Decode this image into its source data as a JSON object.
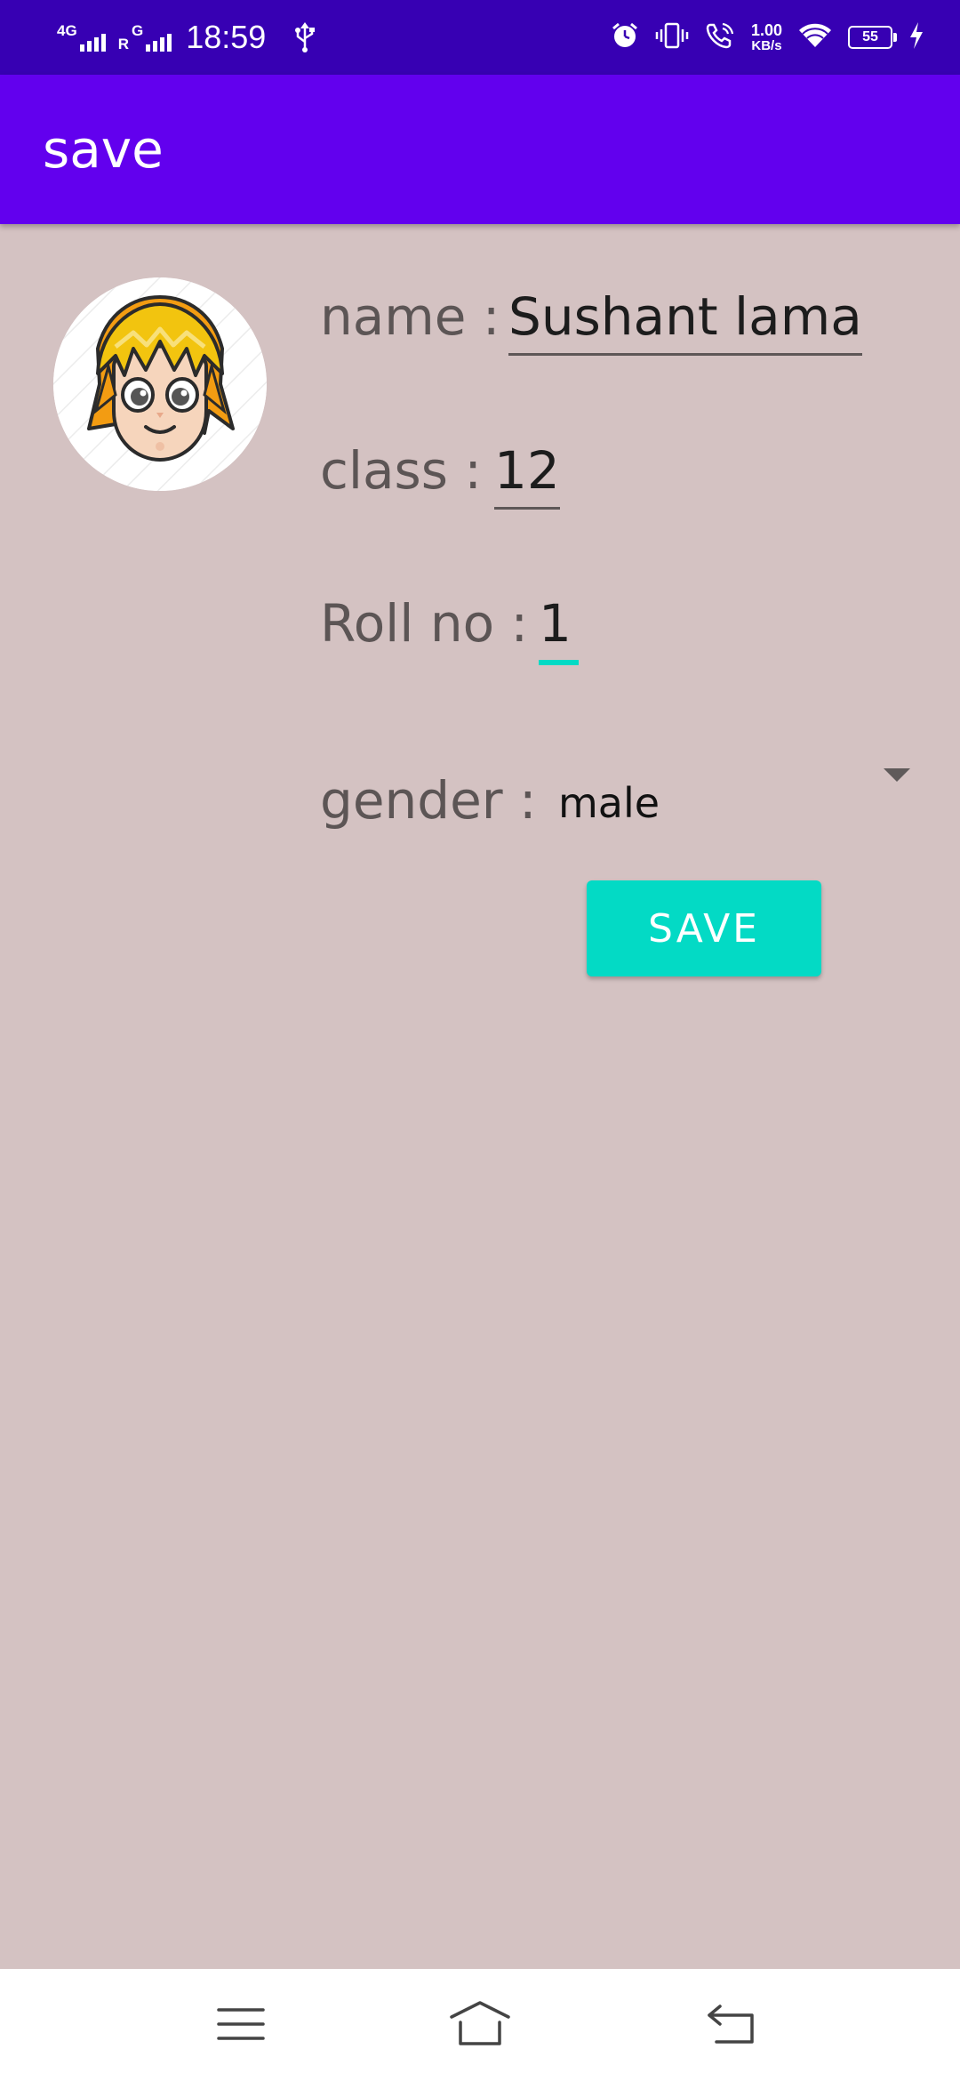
{
  "status_bar": {
    "network_1": "4G",
    "network_2": "R",
    "network_2_sub": "G",
    "time": "18:59",
    "speed_value": "1.00",
    "speed_unit": "KB/s",
    "battery": "55",
    "icons": [
      "usb-icon",
      "alarm-icon",
      "vibrate-icon",
      "wifi-call-icon",
      "wifi-icon",
      "battery-icon",
      "charging-icon"
    ]
  },
  "app_bar": {
    "title": "save"
  },
  "form": {
    "name_label": "name :",
    "name_value": "Sushant lama",
    "class_label": "class :",
    "class_value": "12",
    "roll_label": "Roll no :",
    "roll_value": "1",
    "gender_label": "gender :",
    "gender_value": "male",
    "save_button": "SAVE"
  },
  "nav_bar": {
    "icons": [
      "menu-icon",
      "home-icon",
      "back-icon"
    ]
  },
  "colors": {
    "status_bar": "#3700B3",
    "app_bar": "#6200EE",
    "background": "#D4C2C2",
    "accent": "#03DAC5",
    "label_text": "#5C5555"
  }
}
